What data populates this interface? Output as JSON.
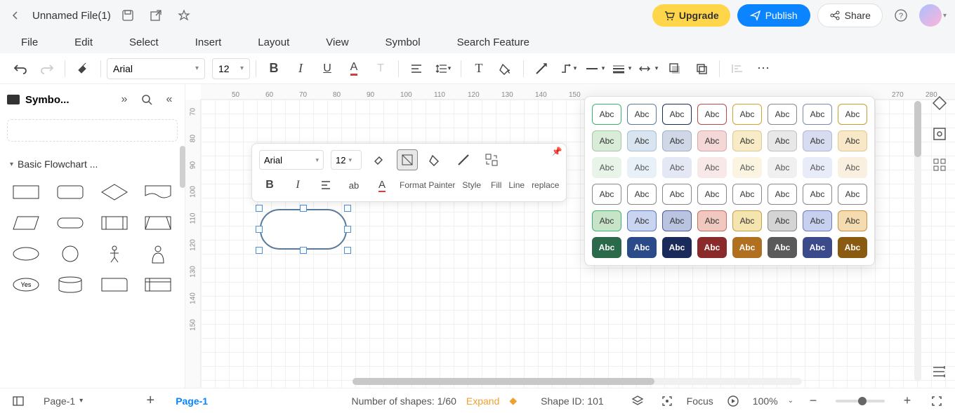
{
  "titlebar": {
    "filename": "Unnamed File(1)",
    "upgrade": "Upgrade",
    "publish": "Publish",
    "share": "Share"
  },
  "menu": {
    "items": [
      "File",
      "Edit",
      "Select",
      "Insert",
      "Layout",
      "View",
      "Symbol",
      "Search Feature"
    ]
  },
  "toolbar": {
    "font": "Arial",
    "size": "12"
  },
  "sidebar": {
    "title": "Symbo...",
    "section": "Basic Flowchart ...",
    "yes_label": "Yes"
  },
  "ruler_h": [
    "50",
    "60",
    "70",
    "80",
    "90",
    "100",
    "110",
    "120",
    "130",
    "140",
    "150",
    "270",
    "280"
  ],
  "ruler_v": [
    "70",
    "80",
    "90",
    "100",
    "110",
    "120",
    "130",
    "140",
    "150"
  ],
  "float": {
    "font": "Arial",
    "size": "12",
    "labels": {
      "format_painter": "Format Painter",
      "style": "Style",
      "fill": "Fill",
      "line": "Line",
      "replace": "replace"
    }
  },
  "style_gallery": {
    "sample": "Abc",
    "rows": [
      [
        {
          "bg": "#ffffff",
          "border": "#3cb371",
          "color": "#333"
        },
        {
          "bg": "#ffffff",
          "border": "#5a7a9c",
          "color": "#333"
        },
        {
          "bg": "#ffffff",
          "border": "#1a2a5a",
          "color": "#333"
        },
        {
          "bg": "#ffffff",
          "border": "#b94a4a",
          "color": "#333"
        },
        {
          "bg": "#ffffff",
          "border": "#d4a030",
          "color": "#333"
        },
        {
          "bg": "#ffffff",
          "border": "#888888",
          "color": "#333"
        },
        {
          "bg": "#ffffff",
          "border": "#7a8ab0",
          "color": "#333"
        },
        {
          "bg": "#ffffff",
          "border": "#c4a030",
          "color": "#333"
        }
      ],
      [
        {
          "bg": "#d8ecd8",
          "border": "#a8c8a8",
          "color": "#333"
        },
        {
          "bg": "#d8e4f0",
          "border": "#a8c0d8",
          "color": "#333"
        },
        {
          "bg": "#d0d8e8",
          "border": "#a0b0c8",
          "color": "#333"
        },
        {
          "bg": "#f4d8d8",
          "border": "#d8a8a8",
          "color": "#333"
        },
        {
          "bg": "#f8ecc8",
          "border": "#e0c890",
          "color": "#333"
        },
        {
          "bg": "#e8e8e8",
          "border": "#c0c0c0",
          "color": "#333"
        },
        {
          "bg": "#d8dcf0",
          "border": "#b0b8d8",
          "color": "#333"
        },
        {
          "bg": "#f8e8c8",
          "border": "#e0c890",
          "color": "#333"
        }
      ],
      [
        {
          "bg": "#e8f4e8",
          "border": "transparent",
          "color": "#555"
        },
        {
          "bg": "#e8f0f8",
          "border": "transparent",
          "color": "#555"
        },
        {
          "bg": "#e4e8f4",
          "border": "transparent",
          "color": "#555"
        },
        {
          "bg": "#f8e8e8",
          "border": "transparent",
          "color": "#555"
        },
        {
          "bg": "#faf4e0",
          "border": "transparent",
          "color": "#555"
        },
        {
          "bg": "#f0f0f0",
          "border": "transparent",
          "color": "#555"
        },
        {
          "bg": "#e8ecf8",
          "border": "transparent",
          "color": "#555"
        },
        {
          "bg": "#faf0e0",
          "border": "transparent",
          "color": "#555"
        }
      ],
      [
        {
          "bg": "#ffffff",
          "border": "#888",
          "color": "#333"
        },
        {
          "bg": "#ffffff",
          "border": "#888",
          "color": "#333"
        },
        {
          "bg": "#ffffff",
          "border": "#888",
          "color": "#333"
        },
        {
          "bg": "#ffffff",
          "border": "#888",
          "color": "#333"
        },
        {
          "bg": "#ffffff",
          "border": "#888",
          "color": "#333"
        },
        {
          "bg": "#ffffff",
          "border": "#888",
          "color": "#333"
        },
        {
          "bg": "#ffffff",
          "border": "#888",
          "color": "#333"
        },
        {
          "bg": "#ffffff",
          "border": "#888",
          "color": "#333"
        }
      ],
      [
        {
          "bg": "#c8e4c8",
          "border": "#3cb371",
          "color": "#333"
        },
        {
          "bg": "#c8d4f0",
          "border": "#5a7ac0",
          "color": "#333"
        },
        {
          "bg": "#b8c4e0",
          "border": "#4a5a9c",
          "color": "#333"
        },
        {
          "bg": "#f0c8c0",
          "border": "#c07060",
          "color": "#333"
        },
        {
          "bg": "#f4e4b0",
          "border": "#c8a040",
          "color": "#333"
        },
        {
          "bg": "#d4d4d4",
          "border": "#888",
          "color": "#333"
        },
        {
          "bg": "#c8d0f0",
          "border": "#6a7ac0",
          "color": "#333"
        },
        {
          "bg": "#f4dcb0",
          "border": "#c89040",
          "color": "#333"
        }
      ],
      [
        {
          "bg": "#2a6a4a",
          "border": "#2a6a4a",
          "color": "#fff"
        },
        {
          "bg": "#2a4a8a",
          "border": "#2a4a8a",
          "color": "#fff"
        },
        {
          "bg": "#1a2a5a",
          "border": "#1a2a5a",
          "color": "#fff"
        },
        {
          "bg": "#8a2a2a",
          "border": "#8a2a2a",
          "color": "#fff"
        },
        {
          "bg": "#b07020",
          "border": "#b07020",
          "color": "#fff"
        },
        {
          "bg": "#5a5a5a",
          "border": "#5a5a5a",
          "color": "#fff"
        },
        {
          "bg": "#3a4a8a",
          "border": "#3a4a8a",
          "color": "#fff"
        },
        {
          "bg": "#8a5a10",
          "border": "#8a5a10",
          "color": "#fff"
        }
      ]
    ]
  },
  "status": {
    "page_select": "Page-1",
    "page_tab": "Page-1",
    "shapes_label": "Number of shapes:",
    "shapes_count": "1/60",
    "expand": "Expand",
    "shape_id_label": "Shape ID:",
    "shape_id": "101",
    "focus": "Focus",
    "zoom": "100%"
  }
}
